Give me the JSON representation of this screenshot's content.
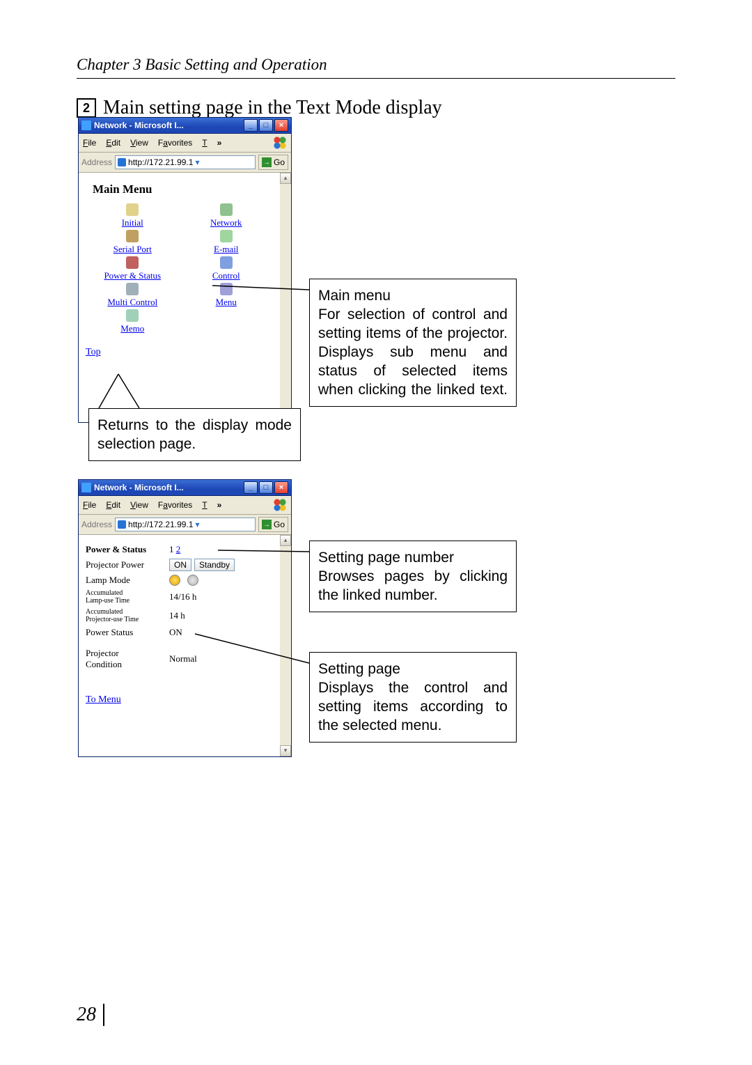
{
  "chapter": "Chapter 3 Basic Setting and Operation",
  "section_number": "2",
  "section_title": "Main setting page in the Text Mode display",
  "page_number": "28",
  "ie": {
    "title": "Network - Microsoft I...",
    "menubar": {
      "file": "File",
      "edit": "Edit",
      "view": "View",
      "favorites": "Favorites",
      "t": "T",
      "more": "»"
    },
    "address_label": "Address",
    "address_value": "http://172.21.99.1",
    "go": "Go"
  },
  "mainmenu": {
    "title": "Main Menu",
    "items": {
      "initial": "Initial",
      "network": "Network",
      "serial": "Serial Port",
      "email": "E-mail",
      "power": "Power & Status",
      "control": "Control",
      "multi": "Multi Control",
      "menu": "Menu",
      "memo": "Memo"
    },
    "top": "Top"
  },
  "status": {
    "heading": "Power & Status",
    "page_current": "1",
    "page_other": "2",
    "rows": {
      "projector_power_label": "Projector Power",
      "btn_on": "ON",
      "btn_standby": "Standby",
      "lamp_mode_label": "Lamp Mode",
      "acc_lamp_label_a": "Accumulated",
      "acc_lamp_label_b": "Lamp-use Time",
      "acc_lamp_value": "14/16 h",
      "acc_proj_label_a": "Accumulated",
      "acc_proj_label_b": "Projector-use Time",
      "acc_proj_value": "14 h",
      "power_status_label": "Power Status",
      "power_status_value": "ON",
      "projector_condition_label_a": "Projector",
      "projector_condition_label_b": "Condition",
      "projector_condition_value": "Normal"
    },
    "to_menu": "To Menu"
  },
  "callouts": {
    "return": "Returns to the display mode selection page.",
    "mainmenu_title": "Main menu",
    "mainmenu_body": "For selection of  control and setting items of the projector. Displays sub menu and status of selected items when clicking the linked text.",
    "spn_title": "Setting page number",
    "spn_body": "Browses pages by clicking the linked number.",
    "sp_title": "Setting page",
    "sp_body": "Displays the control and setting items according to the selected menu."
  }
}
